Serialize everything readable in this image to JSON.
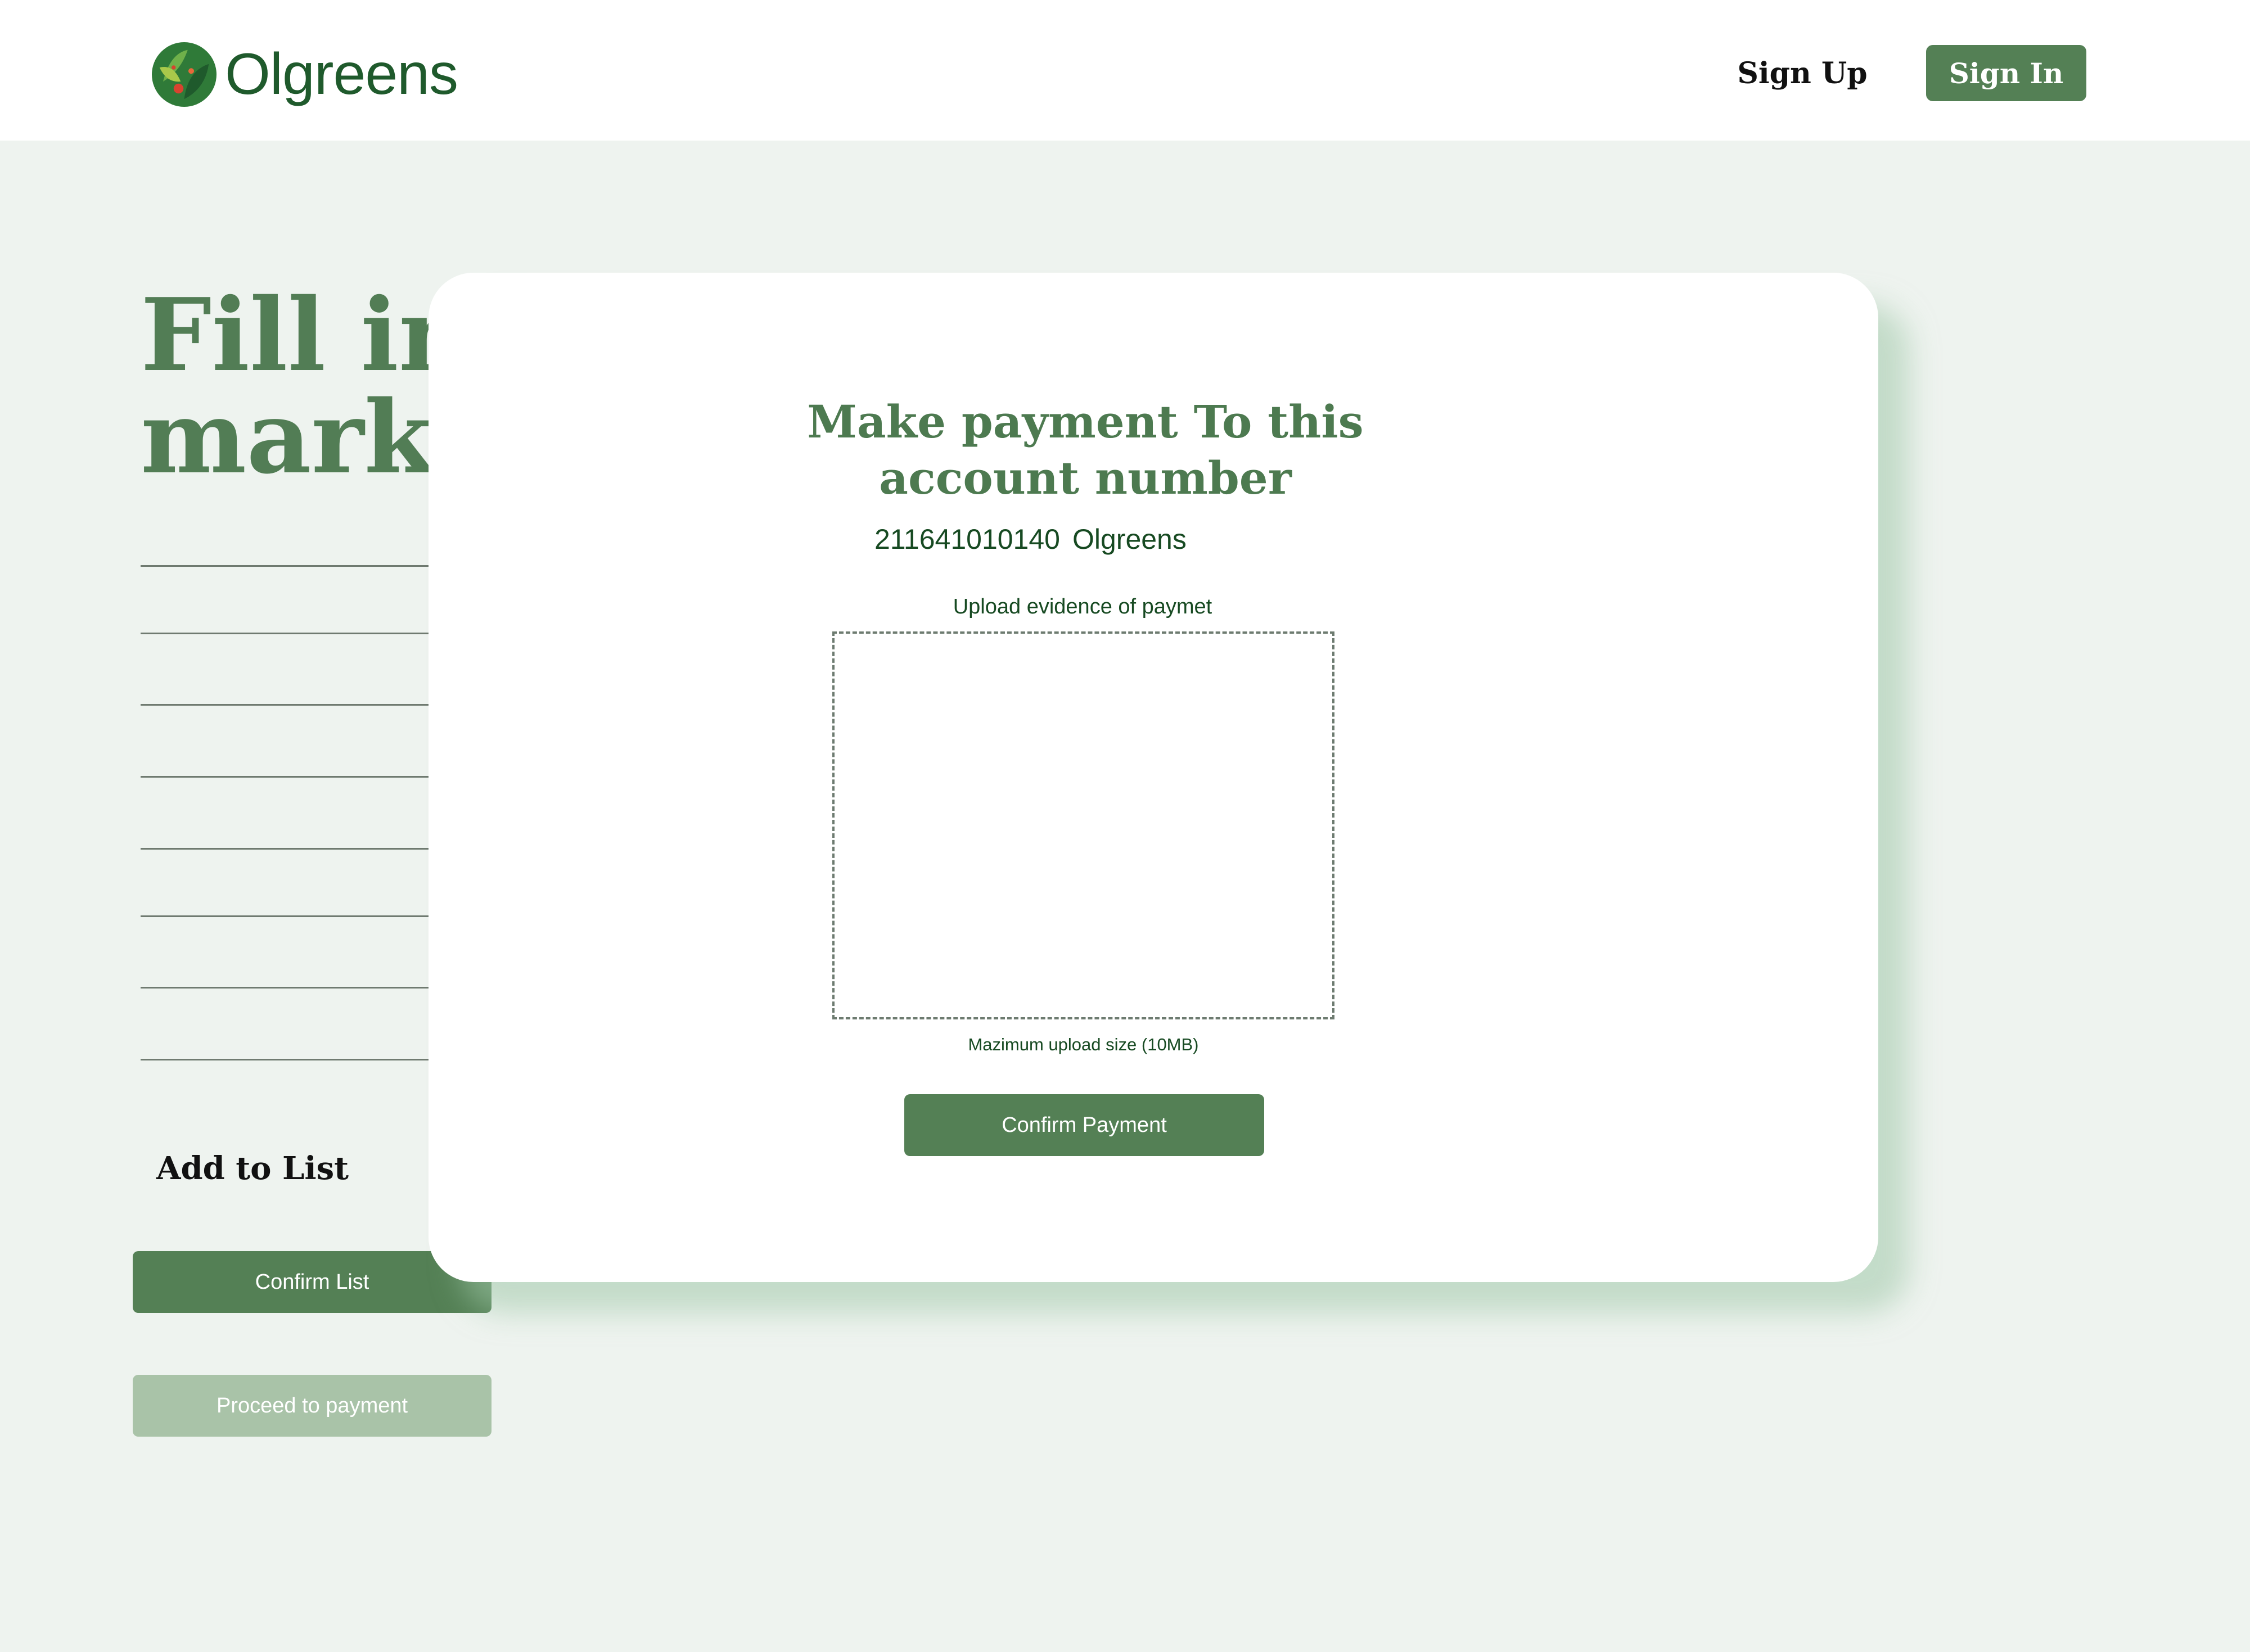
{
  "header": {
    "brand": "Olgreens",
    "nav": {
      "sign_up": "Sign Up",
      "sign_in": "Sign In"
    }
  },
  "background_page": {
    "heading": "Fill in\nmarke",
    "add_to_list": "Add to List",
    "confirm_list": "Confirm List",
    "proceed_to_payment": "Proceed to payment"
  },
  "modal": {
    "title": "Make payment To this account number",
    "account_number": "211641010140",
    "account_name": "Olgreens",
    "upload_label": "Upload evidence of paymet",
    "upload_hint": "Mazimum upload size (10MB)",
    "confirm_payment": "Confirm Payment"
  },
  "colors": {
    "brand_green": "#548055",
    "dark_green": "#174a22",
    "heading_green": "#527d55",
    "disabled_green": "#a9c3a8",
    "page_background": "#eef3ef"
  }
}
